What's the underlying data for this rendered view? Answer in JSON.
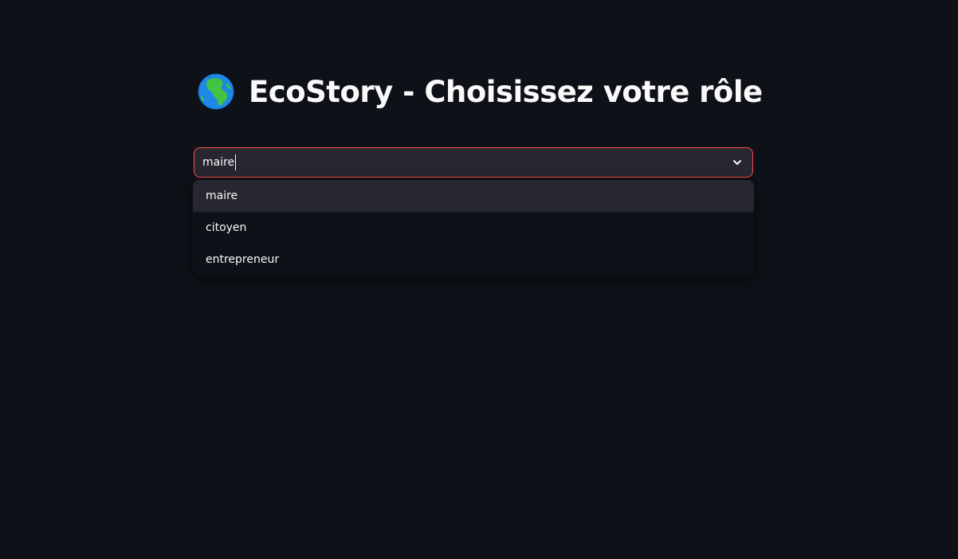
{
  "header": {
    "title": "EcoStory - Choisissez votre rôle",
    "icon": "globe-africa-icon"
  },
  "role_select": {
    "value": "maire",
    "border_color": "#ff4b4b",
    "options": [
      {
        "label": "maire",
        "highlighted": true
      },
      {
        "label": "citoyen",
        "highlighted": false
      },
      {
        "label": "entrepreneur",
        "highlighted": false
      }
    ]
  },
  "colors": {
    "background": "#0e1117",
    "input_background": "#262730",
    "text": "#fafafa",
    "accent": "#ff4b4b"
  }
}
